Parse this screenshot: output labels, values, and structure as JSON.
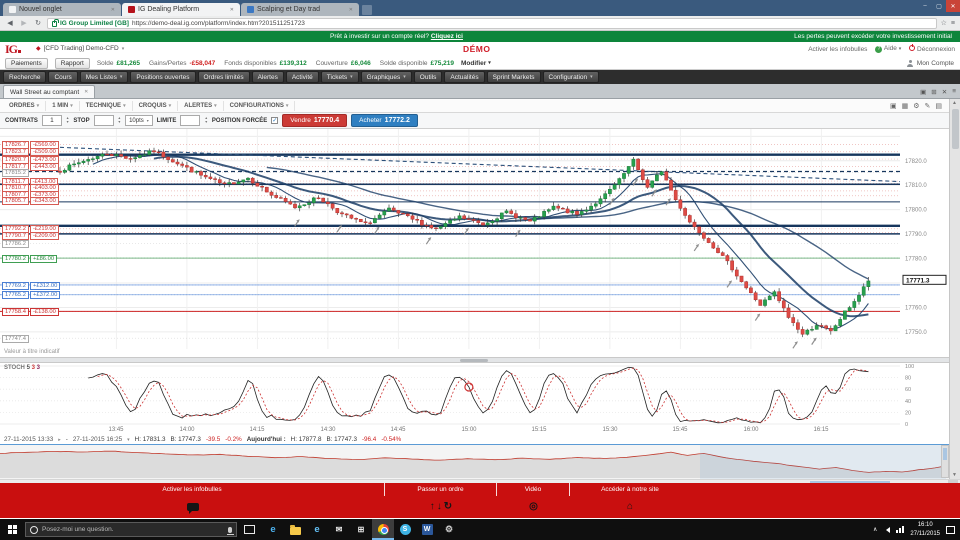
{
  "browser": {
    "tabs": [
      {
        "title": "Nouvel onglet",
        "active": false,
        "fav": "#f1f3f4"
      },
      {
        "title": "IG Dealing Platform",
        "active": true,
        "fav": "#b5121b"
      },
      {
        "title": "Scalping et Day trad",
        "active": false,
        "fav": "#3b78c3"
      }
    ],
    "security_badge": "IG Group Limited [GB]",
    "url": "https://demo-deal.ig.com/platform/index.htm?201511251723"
  },
  "banner": {
    "question": "Prêt à investir sur un compte réel?",
    "link": "Cliquez ici",
    "warning": "Les pertes peuvent excéder votre investissement initial"
  },
  "header": {
    "logo_text": "IG",
    "account_label": "[CFD Trading] Demo-CFD",
    "demo": "DÉMO",
    "tooltips_link": "Activer les infobulles",
    "help": "Aide",
    "logout": "Déconnexion",
    "my_account": "Mon Compte"
  },
  "account_bar": {
    "buttons": [
      "Paiements",
      "Rapport"
    ],
    "fields": [
      {
        "label": "Solde",
        "value": "£81,265",
        "tone": "pos"
      },
      {
        "label": "Gains/Pertes",
        "value": "-£58,047",
        "tone": "neg"
      },
      {
        "label": "Fonds disponibles",
        "value": "£139,312",
        "tone": "pos"
      },
      {
        "label": "Couverture",
        "value": "£6,046",
        "tone": "pos"
      },
      {
        "label": "Solde disponible",
        "value": "£75,219",
        "tone": "pos"
      }
    ],
    "modify": "Modifier"
  },
  "menu": [
    {
      "label": "Recherche"
    },
    {
      "label": "Cours"
    },
    {
      "label": "Mes Listes",
      "caret": true
    },
    {
      "label": "Positions ouvertes"
    },
    {
      "label": "Ordres limités"
    },
    {
      "label": "Alertes"
    },
    {
      "label": "Activité"
    },
    {
      "label": "Tickets",
      "caret": true
    },
    {
      "label": "Graphiques",
      "caret": true
    },
    {
      "label": "Outils"
    },
    {
      "label": "Actualités"
    },
    {
      "label": "Sprint Markets"
    },
    {
      "label": "Configuration",
      "caret": true
    }
  ],
  "workspace": {
    "tab_title": "Wall Street au comptant"
  },
  "chart_toolbar": [
    "ORDRES",
    "1 MIN",
    "TECHNIQUE",
    "CROQUIS",
    "ALERTES",
    "CONFIGURATIONS"
  ],
  "deal_ticket": {
    "contracts_label": "CONTRATS",
    "contracts_value": "1",
    "stop_label": "STOP",
    "stop_option": "10pts",
    "limit_label": "LIMITE",
    "forced_label": "POSITION FORCÉE",
    "forced_checked": true,
    "sell_label": "Vendre",
    "sell_price": "17770.4",
    "buy_label": "Acheter",
    "buy_price": "17772.2"
  },
  "orders": [
    {
      "price": "17826.7",
      "pnl": "-£569.00",
      "kind": "loss"
    },
    {
      "price": "17823.7",
      "pnl": "-£509.00",
      "kind": "loss"
    },
    {
      "price": "17820.7",
      "pnl": "-£473.00",
      "kind": "loss"
    },
    {
      "price": "17817.7",
      "pnl": "-£443.00",
      "kind": "loss"
    },
    {
      "price": "17815.2",
      "kind": "plain"
    },
    {
      "price": "17811.7",
      "pnl": "-£413.00",
      "kind": "loss"
    },
    {
      "price": "17810.7",
      "pnl": "-£403.00",
      "kind": "loss"
    },
    {
      "price": "17807.7",
      "pnl": "-£373.00",
      "kind": "loss"
    },
    {
      "price": "17805.7",
      "pnl": "-£343.00",
      "kind": "loss"
    },
    {
      "price": "17792.2",
      "pnl": "-£219.00",
      "kind": "loss"
    },
    {
      "price": "17790.7",
      "pnl": "-£209.00",
      "kind": "loss"
    },
    {
      "price": "17786.2",
      "kind": "plain"
    },
    {
      "price": "17780.2",
      "pnl": "+£86.00",
      "kind": "profit"
    },
    {
      "price": "17769.2",
      "pnl": "+£312.00",
      "kind": "order"
    },
    {
      "price": "17765.2",
      "pnl": "+£372.00",
      "kind": "order"
    },
    {
      "price": "17758.4",
      "pnl": "-£138.00",
      "kind": "stop"
    },
    {
      "price": "17747.4",
      "kind": "plain"
    }
  ],
  "indicative_note": "Valeur à titre indicatif",
  "chart_data": {
    "type": "candlestick",
    "title": "Wall Street au comptant",
    "interval": "1 MIN",
    "session_start": "27-11-2015 13:33",
    "session_end": "27-11-2015 16:25",
    "current_price": 17771.3,
    "high": 17831.3,
    "low": 17747.3,
    "ylim": [
      17743,
      17833
    ],
    "x_ticks": [
      "13:45",
      "14:00",
      "14:15",
      "14:30",
      "14:45",
      "15:00",
      "15:15",
      "15:30",
      "15:45",
      "16:00",
      "16:15"
    ],
    "y_ticks": [
      17820,
      17810,
      17800,
      17790,
      17780,
      17760,
      17750
    ],
    "price_path": [
      [
        0,
        17816
      ],
      [
        5,
        17820
      ],
      [
        10,
        17823
      ],
      [
        15,
        17821
      ],
      [
        20,
        17824
      ],
      [
        25,
        17819
      ],
      [
        30,
        17814
      ],
      [
        35,
        17810
      ],
      [
        40,
        17813
      ],
      [
        45,
        17806
      ],
      [
        50,
        17801
      ],
      [
        55,
        17805
      ],
      [
        60,
        17798
      ],
      [
        65,
        17794
      ],
      [
        70,
        17800
      ],
      [
        75,
        17796
      ],
      [
        80,
        17792
      ],
      [
        85,
        17797
      ],
      [
        90,
        17794
      ],
      [
        95,
        17799
      ],
      [
        100,
        17795
      ],
      [
        105,
        17801
      ],
      [
        110,
        17798
      ],
      [
        115,
        17804
      ],
      [
        119,
        17812
      ],
      [
        122,
        17820
      ],
      [
        125,
        17809
      ],
      [
        128,
        17816
      ],
      [
        131,
        17804
      ],
      [
        134,
        17795
      ],
      [
        137,
        17789
      ],
      [
        140,
        17783
      ],
      [
        143,
        17776
      ],
      [
        146,
        17768
      ],
      [
        149,
        17761
      ],
      [
        152,
        17766
      ],
      [
        155,
        17756
      ],
      [
        158,
        17749
      ],
      [
        161,
        17753
      ],
      [
        164,
        17750
      ],
      [
        167,
        17758
      ],
      [
        170,
        17765
      ],
      [
        172,
        17771
      ]
    ],
    "levels": [
      {
        "price": 17822.5,
        "width": 2.4
      },
      {
        "price": 17815.6,
        "width": 1.2,
        "dash": true
      },
      {
        "price": 17810.4,
        "width": 1.4
      },
      {
        "price": 17803.2,
        "width": 1.0
      },
      {
        "price": 17793.4,
        "width": 2.4
      },
      {
        "price": 17790.1,
        "width": 1.4
      }
    ],
    "stop_line": 17758.4,
    "profit_line": 17780.2,
    "order_lines": [
      17769.2,
      17765.2
    ],
    "marker_minutes": [
      51,
      60,
      68,
      79,
      87,
      98,
      118,
      123,
      127,
      130,
      136,
      143,
      149,
      157,
      161
    ]
  },
  "stoch": {
    "label": "STOCH",
    "params": [
      "5",
      "3",
      "3"
    ],
    "y_ticks": [
      "100",
      "80",
      "60",
      "40",
      "20",
      "0"
    ]
  },
  "footer": {
    "range_start": "27-11-2015 13:33",
    "range_sep": "-",
    "range_end": "27-11-2015 16:25",
    "high_label": "H:",
    "high": "17831.3",
    "low_label": "B:",
    "low": "17747.3",
    "change": "-39.5",
    "change_pct": "-0.2%",
    "today_label": "Aujourd'hui :",
    "today_high": "H: 17877.8",
    "today_low": "B: 17747.3",
    "today_change": "-96.4",
    "today_change_pct": "-0.54%"
  },
  "action_bar": [
    {
      "label": "Activer les infobulles",
      "icon": "speech-bubble"
    },
    {
      "label": "Passer un ordre",
      "icon": "order-arrows"
    },
    {
      "label": "Vidéo",
      "icon": "target"
    },
    {
      "label": "Accéder à notre site",
      "icon": "home"
    }
  ],
  "taskbar": {
    "search_placeholder": "Posez-moi une question.",
    "time": "16:10",
    "date": "27/11/2015",
    "apps": [
      "edge",
      "file-explorer",
      "internet-explorer",
      "mail",
      "store",
      "chrome",
      "skype",
      "word",
      "settings"
    ]
  }
}
